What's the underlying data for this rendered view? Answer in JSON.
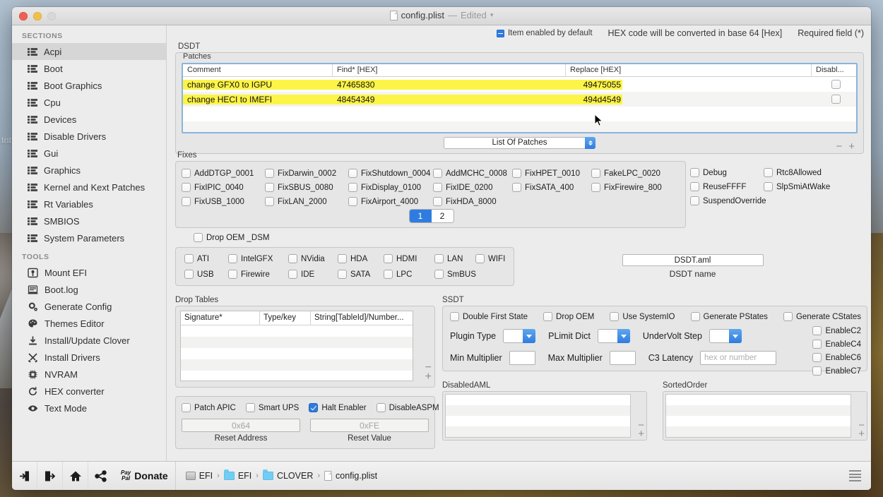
{
  "window": {
    "title": "config.plist",
    "title_separator": "—",
    "edited": "Edited"
  },
  "header_hints": {
    "item_enabled": "Item enabled by default",
    "hex_note": "HEX code will be converted in base 64 [Hex]",
    "required": "Required field (*)"
  },
  "sidebar": {
    "sections_header": "SECTIONS",
    "tools_header": "TOOLS",
    "sections": [
      {
        "label": "Acpi",
        "icon": "list-grid-icon",
        "active": true
      },
      {
        "label": "Boot",
        "icon": "list-grid-icon",
        "active": false
      },
      {
        "label": "Boot Graphics",
        "icon": "list-grid-icon",
        "active": false
      },
      {
        "label": "Cpu",
        "icon": "list-grid-icon",
        "active": false
      },
      {
        "label": "Devices",
        "icon": "list-grid-icon",
        "active": false
      },
      {
        "label": "Disable Drivers",
        "icon": "list-grid-icon",
        "active": false
      },
      {
        "label": "Gui",
        "icon": "list-grid-icon",
        "active": false
      },
      {
        "label": "Graphics",
        "icon": "list-grid-icon",
        "active": false
      },
      {
        "label": "Kernel and Kext Patches",
        "icon": "list-grid-icon",
        "active": false
      },
      {
        "label": "Rt Variables",
        "icon": "list-grid-icon",
        "active": false
      },
      {
        "label": "SMBIOS",
        "icon": "list-grid-icon",
        "active": false
      },
      {
        "label": "System Parameters",
        "icon": "list-grid-icon",
        "active": false
      }
    ],
    "tools": [
      {
        "label": "Mount EFI",
        "icon": "mount-efi-icon"
      },
      {
        "label": "Boot.log",
        "icon": "boot-log-icon"
      },
      {
        "label": "Generate Config",
        "icon": "gear-icon"
      },
      {
        "label": "Themes Editor",
        "icon": "palette-icon"
      },
      {
        "label": "Install/Update Clover",
        "icon": "download-icon"
      },
      {
        "label": "Install Drivers",
        "icon": "tools-icon"
      },
      {
        "label": "NVRAM",
        "icon": "chip-icon"
      },
      {
        "label": "HEX converter",
        "icon": "refresh-icon"
      },
      {
        "label": "Text Mode",
        "icon": "eye-icon"
      }
    ]
  },
  "dsdt": {
    "group_label": "DSDT",
    "patches_label": "Patches",
    "columns": [
      "Comment",
      "Find* [HEX]",
      "Replace [HEX]",
      "Disabl..."
    ],
    "rows": [
      {
        "comment": "change GFX0 to IGPU",
        "find": "47465830",
        "replace": "49475055",
        "disabled": false,
        "highlight": true
      },
      {
        "comment": "change HECI to IMEFI",
        "find": "48454349",
        "replace": "494d4549",
        "disabled": false,
        "highlight": true
      }
    ],
    "empty_rows": 2,
    "list_of_patches": "List Of Patches",
    "remove_label": "−",
    "add_label": "+"
  },
  "fixes": {
    "label": "Fixes",
    "left_grid": [
      "AddDTGP_0001",
      "FixDarwin_0002",
      "FixShutdown_0004",
      "AddMCHC_0008",
      "FixHPET_0010",
      "FakeLPC_0020",
      "FixIPIC_0040",
      "FixSBUS_0080",
      "FixDisplay_0100",
      "FixIDE_0200",
      "FixSATA_400",
      "FixFirewire_800",
      "FixUSB_1000",
      "FixLAN_2000",
      "FixAirport_4000",
      "FixHDA_8000"
    ],
    "right_grid": [
      "Debug",
      "Rtc8Allowed",
      "ReuseFFFF",
      "SlpSmiAtWake",
      "SuspendOverride"
    ],
    "pager": [
      "1",
      "2"
    ],
    "pager_selected": "1",
    "drop_oem_dsm": "Drop OEM _DSM"
  },
  "devices": {
    "row1": [
      "ATI",
      "IntelGFX",
      "NVidia",
      "HDA",
      "HDMI",
      "LAN",
      "WIFI"
    ],
    "row2": [
      "USB",
      "Firewire",
      "IDE",
      "SATA",
      "LPC",
      "SmBUS"
    ],
    "dsdt_name_value": "DSDT.aml",
    "dsdt_name_label": "DSDT name"
  },
  "drop_tables": {
    "label": "Drop Tables",
    "columns": [
      "Signature*",
      "Type/key",
      "String[TableId]/Number..."
    ],
    "remove_label": "−",
    "add_label": "+"
  },
  "apic": {
    "checks": [
      {
        "label": "Patch APIC",
        "checked": false
      },
      {
        "label": "Smart UPS",
        "checked": false
      },
      {
        "label": "Halt Enabler",
        "checked": true
      },
      {
        "label": "DisableASPM",
        "checked": false
      }
    ],
    "reset_address_placeholder": "0x64",
    "reset_address_label": "Reset Address",
    "reset_value_placeholder": "0xFE",
    "reset_value_label": "Reset Value"
  },
  "ssdt": {
    "label": "SSDT",
    "top_checks": [
      "Double First State",
      "Drop OEM",
      "Use SystemIO",
      "Generate PStates",
      "Generate CStates"
    ],
    "plugin_type_label": "Plugin Type",
    "plugin_type_value": "",
    "plimit_dict_label": "PLimit Dict",
    "plimit_dict_value": "",
    "undervolt_step_label": "UnderVolt Step",
    "undervolt_step_value": "",
    "min_multiplier_label": "Min Multiplier",
    "min_multiplier_value": "",
    "max_multiplier_label": "Max Multiplier",
    "max_multiplier_value": "",
    "c3_latency_label": "C3 Latency",
    "c3_latency_placeholder": "hex or number",
    "enable_checks": [
      "EnableC2",
      "EnableC4",
      "EnableC6",
      "EnableC7"
    ]
  },
  "aml": {
    "disabled_label": "DisabledAML",
    "sorted_label": "SortedOrder",
    "remove_label": "−",
    "add_label": "+"
  },
  "toolbar": {
    "buttons": [
      {
        "name": "import-icon",
        "label": ""
      },
      {
        "name": "export-icon",
        "label": ""
      },
      {
        "name": "home-icon",
        "label": ""
      },
      {
        "name": "share-icon",
        "label": ""
      }
    ],
    "paypal_line1": "Pay",
    "paypal_line2": "Pal",
    "donate": "Donate",
    "breadcrumb": [
      {
        "label": "EFI",
        "icon": "disk-icon"
      },
      {
        "label": "EFI",
        "icon": "folder-icon"
      },
      {
        "label": "CLOVER",
        "icon": "folder-icon"
      },
      {
        "label": "config.plist",
        "icon": "file-icon"
      }
    ],
    "separator": "›"
  },
  "desktop": {
    "partial_text": "Int"
  },
  "colors": {
    "accent_blue": "#2f7ce0",
    "highlight_yellow": "#fcf446",
    "table_border_blue": "#8ab4dd",
    "window_bg": "#ececec"
  }
}
